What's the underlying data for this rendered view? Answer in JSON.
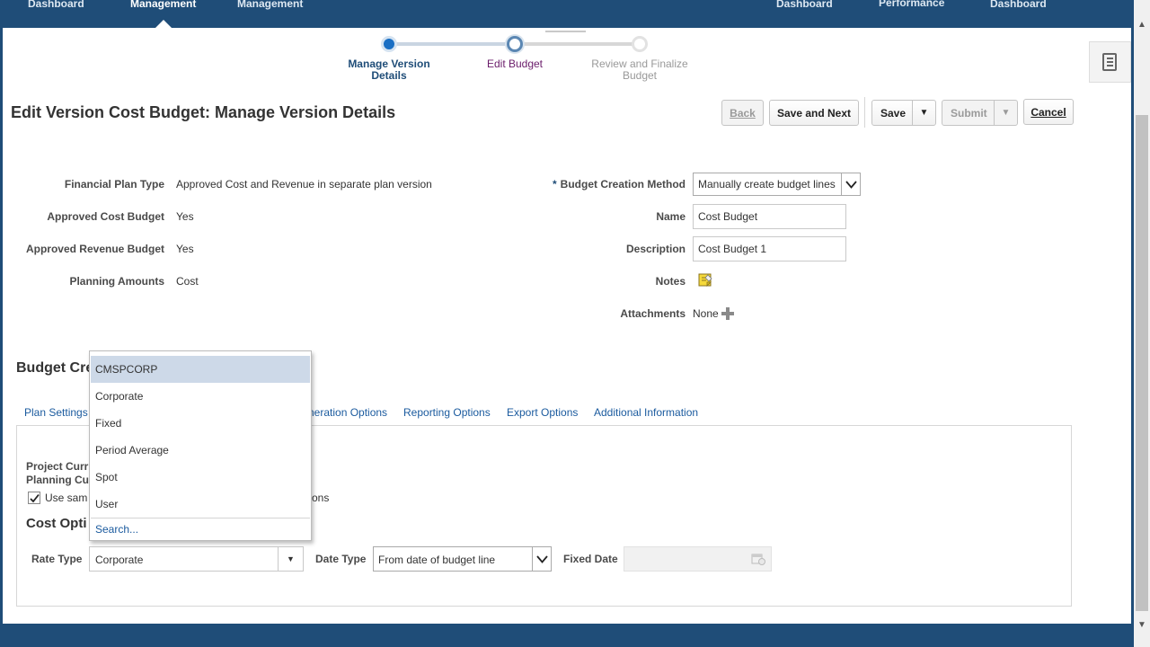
{
  "nav": {
    "items": [
      "Dashboard",
      "Management",
      "Management",
      "Dashboard",
      "Performance",
      "Dashboard"
    ],
    "active_index": 1
  },
  "train": {
    "steps": [
      {
        "label_line1": "Manage Version",
        "label_line2": "Details",
        "state": "current"
      },
      {
        "label_line1": "Edit Budget",
        "label_line2": "",
        "state": "next"
      },
      {
        "label_line1": "Review and Finalize",
        "label_line2": "Budget",
        "state": "disabled"
      }
    ]
  },
  "page": {
    "title": "Edit Version Cost Budget: Manage Version Details"
  },
  "toolbar": {
    "back_label": "Back",
    "save_next_label": "Save and Next",
    "save_label": "Save",
    "submit_label": "Submit",
    "cancel_label": "Cancel"
  },
  "details": {
    "financial_plan_type_label": "Financial Plan Type",
    "financial_plan_type_value": "Approved Cost and Revenue in separate plan version",
    "approved_cost_label": "Approved Cost Budget",
    "approved_cost_value": "Yes",
    "approved_revenue_label": "Approved Revenue Budget",
    "approved_revenue_value": "Yes",
    "planning_amounts_label": "Planning Amounts",
    "planning_amounts_value": "Cost",
    "creation_method_label": "Budget Creation Method",
    "creation_method_value": "Manually create budget lines",
    "name_label": "Name",
    "name_value": "Cost Budget",
    "description_label": "Description",
    "description_value": "Cost Budget 1",
    "notes_label": "Notes",
    "attachments_label": "Attachments",
    "attachments_value": "None"
  },
  "section": {
    "title_visible": "Budget Cre"
  },
  "tabs": [
    {
      "label": "Plan Settings"
    },
    {
      "label": "neration Options"
    },
    {
      "label": "Reporting Options"
    },
    {
      "label": "Export Options"
    },
    {
      "label": "Additional Information"
    }
  ],
  "currency": {
    "project_label": "Project Curr",
    "planning_label": "Planning Cu",
    "checkbox_label_start": "Use sam",
    "checkbox_label_end": "ons",
    "checked": true
  },
  "cost_options": {
    "title_visible": "Cost Opti",
    "rate_type_label": "Rate Type",
    "rate_type_value": "Corporate",
    "date_type_label": "Date Type",
    "date_type_value": "From date of budget line",
    "fixed_date_label": "Fixed Date",
    "fixed_date_value": ""
  },
  "dropdown": {
    "options": [
      "CMSPCORP",
      "Corporate",
      "Fixed",
      "Period Average",
      "Spot",
      "User"
    ],
    "highlighted_index": 0,
    "search_label": "Search..."
  },
  "colors": {
    "brand_bar": "#1f4d78",
    "link": "#1a5a9e",
    "highlight": "#cdd9e8"
  }
}
